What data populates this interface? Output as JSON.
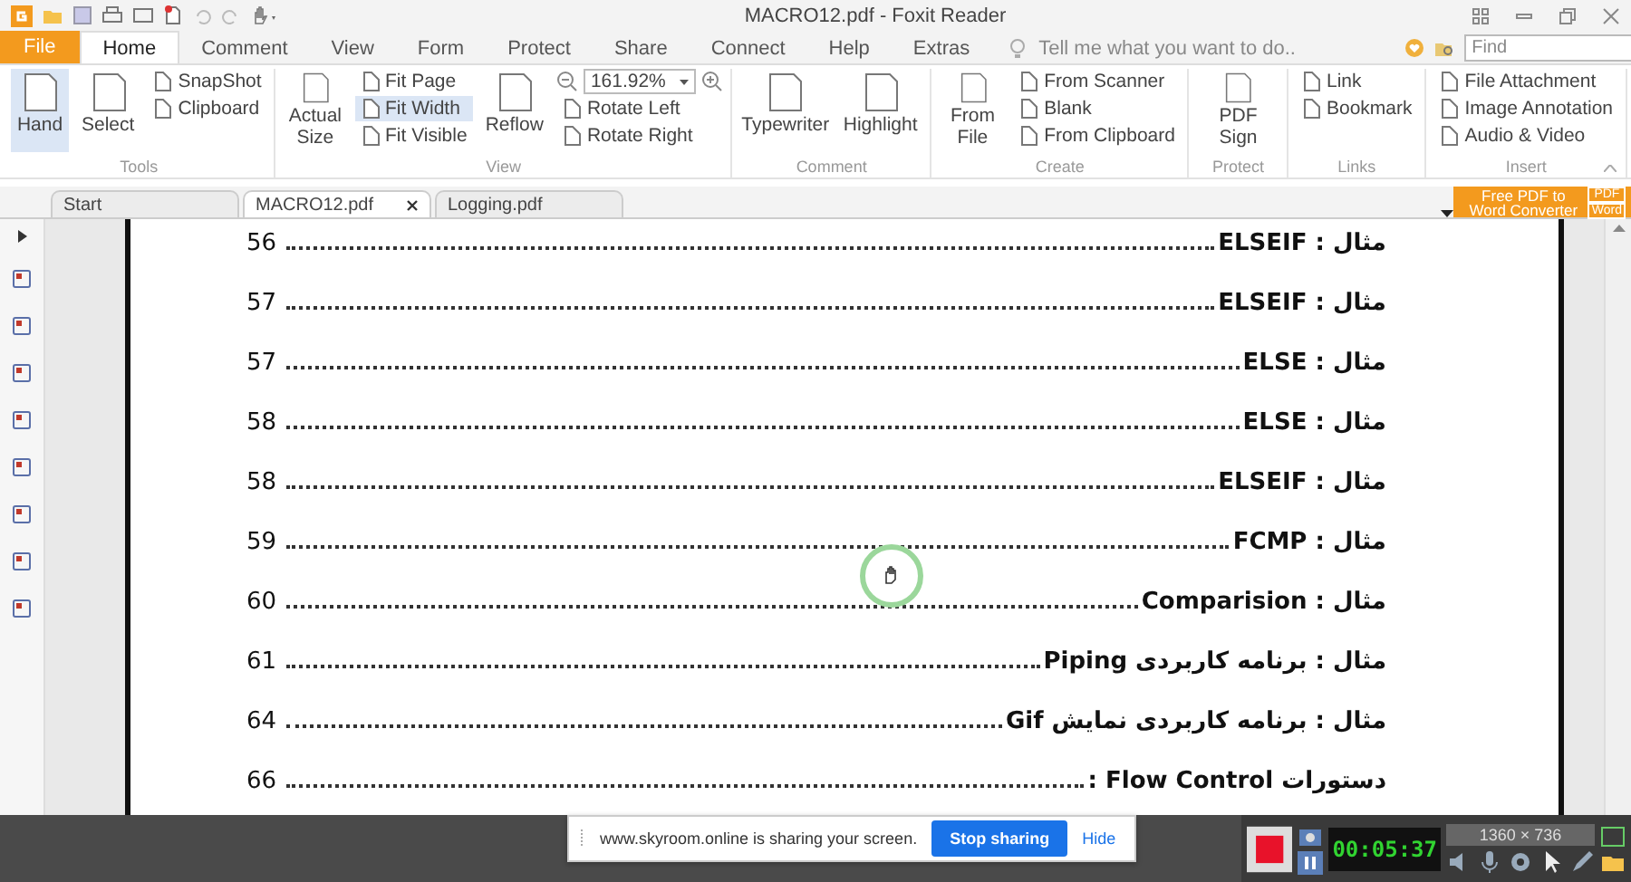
{
  "window": {
    "title": "MACRO12.pdf - Foxit Reader"
  },
  "menu_tabs": [
    {
      "label": "File",
      "kind": "file",
      "selected": false
    },
    {
      "label": "Home",
      "kind": "tab",
      "selected": true
    },
    {
      "label": "Comment",
      "kind": "tab",
      "selected": false
    },
    {
      "label": "View",
      "kind": "tab",
      "selected": false
    },
    {
      "label": "Form",
      "kind": "tab",
      "selected": false
    },
    {
      "label": "Protect",
      "kind": "tab",
      "selected": false
    },
    {
      "label": "Share",
      "kind": "tab",
      "selected": false
    },
    {
      "label": "Connect",
      "kind": "tab",
      "selected": false
    },
    {
      "label": "Help",
      "kind": "tab",
      "selected": false
    },
    {
      "label": "Extras",
      "kind": "tab",
      "selected": false
    }
  ],
  "tell_me": {
    "placeholder": "Tell me what you want to do.."
  },
  "find": {
    "placeholder": "Find"
  },
  "ribbon_groups": [
    {
      "label": "Tools",
      "columns": [
        [
          {
            "label": "Hand",
            "kind": "large",
            "selected": true
          }
        ],
        [
          {
            "label": "Select",
            "kind": "large",
            "selected": false
          }
        ],
        [
          {
            "label": "SnapShot",
            "kind": "small",
            "selected": false
          },
          {
            "label": "Clipboard",
            "kind": "small",
            "selected": false
          }
        ]
      ]
    },
    {
      "label": "View",
      "columns": [
        [
          {
            "label": "Actual Size",
            "kind": "large",
            "selected": false
          }
        ],
        [
          {
            "label": "Fit Page",
            "kind": "small",
            "selected": false
          },
          {
            "label": "Fit Width",
            "kind": "small",
            "selected": true
          },
          {
            "label": "Fit Visible",
            "kind": "small",
            "selected": false
          }
        ],
        [
          {
            "label": "Reflow",
            "kind": "large",
            "selected": false
          }
        ],
        [
          {
            "label": "161.92%",
            "kind": "combo",
            "selected": false
          },
          {
            "label": "Rotate Left",
            "kind": "small",
            "selected": false
          },
          {
            "label": "Rotate Right",
            "kind": "small",
            "selected": false
          }
        ]
      ]
    },
    {
      "label": "Comment",
      "columns": [
        [
          {
            "label": "Typewriter",
            "kind": "large",
            "selected": false
          }
        ],
        [
          {
            "label": "Highlight",
            "kind": "large",
            "selected": false
          }
        ]
      ]
    },
    {
      "label": "Create",
      "columns": [
        [
          {
            "label": "From File",
            "kind": "large",
            "selected": false
          }
        ],
        [
          {
            "label": "From Scanner",
            "kind": "small",
            "selected": false
          },
          {
            "label": "Blank",
            "kind": "small",
            "selected": false
          },
          {
            "label": "From Clipboard",
            "kind": "small",
            "selected": false
          }
        ]
      ]
    },
    {
      "label": "Protect",
      "columns": [
        [
          {
            "label": "PDF Sign",
            "kind": "large",
            "selected": false
          }
        ]
      ]
    },
    {
      "label": "Links",
      "columns": [
        [
          {
            "label": "Link",
            "kind": "small",
            "selected": false
          },
          {
            "label": "Bookmark",
            "kind": "small",
            "selected": false
          }
        ]
      ]
    },
    {
      "label": "Insert",
      "columns": [
        [
          {
            "label": "File Attachment",
            "kind": "small",
            "selected": false
          },
          {
            "label": "Image Annotation",
            "kind": "small",
            "selected": false
          },
          {
            "label": "Audio & Video",
            "kind": "small",
            "selected": false
          }
        ]
      ]
    }
  ],
  "doc_tabs": [
    {
      "label": "Start",
      "selected": false
    },
    {
      "label": "MACRO12.pdf",
      "selected": true
    },
    {
      "label": "Logging.pdf",
      "selected": false
    }
  ],
  "promo": {
    "label": "Free PDF to Word Converter",
    "badges": [
      "PDF",
      "Word"
    ]
  },
  "toc": [
    {
      "title": "مثال : ELSEIF",
      "page": "56"
    },
    {
      "title": "مثال : ELSEIF",
      "page": "57"
    },
    {
      "title": "مثال : ELSE",
      "page": "57"
    },
    {
      "title": "مثال : ELSE",
      "page": "58"
    },
    {
      "title": "مثال :  ELSEIF",
      "page": "58"
    },
    {
      "title": "مثال : FCMP",
      "page": "59"
    },
    {
      "title": "مثال : Comparision",
      "page": "60"
    },
    {
      "title": "مثال : برنامه کاربردی Piping",
      "page": "61"
    },
    {
      "title": "مثال : برنامه کاربردی نمایش Gif",
      "page": "64"
    },
    {
      "title": "دستورات  Flow Control :",
      "page": "66"
    }
  ],
  "share_bar": {
    "message": "www.skyroom.online is sharing your screen.",
    "button": "Stop sharing",
    "link": "Hide"
  },
  "recorder": {
    "time": "00:05:37",
    "resolution": "1360 × 736"
  }
}
